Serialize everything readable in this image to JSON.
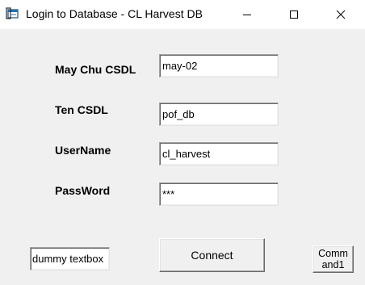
{
  "window": {
    "title": "Login to Database - CL Harvest DB"
  },
  "icons": {
    "app": "database-window-icon",
    "minimize": "minimize-icon",
    "maximize": "maximize-icon",
    "close": "close-icon"
  },
  "form": {
    "server_label": "May Chu CSDL",
    "server_value": "may-02",
    "dbname_label": "Ten CSDL",
    "dbname_value": "pof_db",
    "username_label": "UserName",
    "username_value": "cl_harvest",
    "password_label": "PassWord",
    "password_value": "***"
  },
  "footer": {
    "dummy_value": "dummy textbox",
    "connect_label": "Connect",
    "command_label": "Comm and1"
  }
}
